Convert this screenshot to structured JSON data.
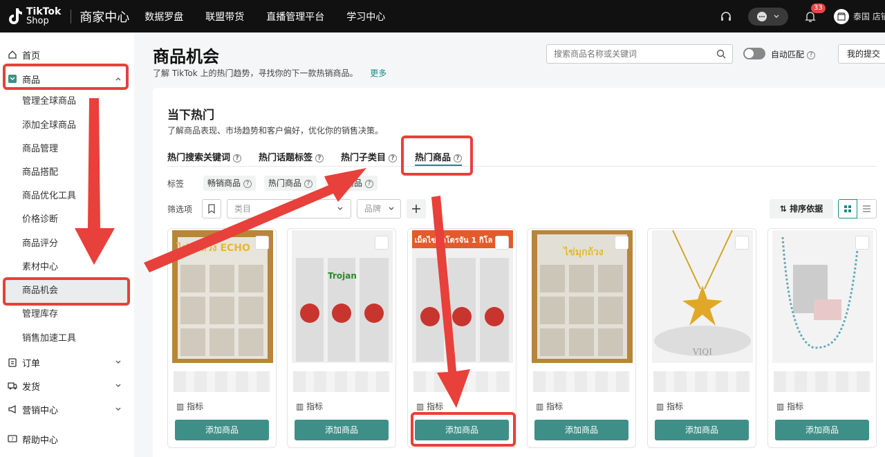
{
  "topbar": {
    "logo_line1": "TikTok",
    "logo_line2": "Shop",
    "app_title": "商家中心",
    "nav": [
      "数据罗盘",
      "联盟带货",
      "直播管理平台",
      "学习中心"
    ],
    "notification_count": "33",
    "store_name": "泰国 店铺"
  },
  "sidebar": {
    "home": "首页",
    "products": "商品",
    "product_subitems": [
      "管理全球商品",
      "添加全球商品",
      "商品管理",
      "商品搭配",
      "商品优化工具",
      "价格诊断",
      "商品评分",
      "素材中心",
      "商品机会",
      "管理库存",
      "销售加速工具"
    ],
    "orders": "订单",
    "shipping": "发货",
    "marketing": "营销中心",
    "help": "帮助中心"
  },
  "header": {
    "title": "商品机会",
    "subtitle": "了解 TikTok 上的热门趋势，寻找你的下一款热销商品。",
    "more_link": "更多",
    "search_placeholder": "搜索商品名称或关键词",
    "auto_match_label": "自动匹配",
    "my_submissions": "我的提交"
  },
  "section": {
    "title": "当下热门",
    "subtitle": "了解商品表现、市场趋势和客户偏好，优化你的销售决策。",
    "tabs": [
      "热门搜索关键词",
      "热门话题标签",
      "热门子类目",
      "热门商品"
    ],
    "active_tab": "热门商品",
    "tag_label": "标签",
    "tags": [
      "畅销商品",
      "热门商品",
      "精选商品"
    ],
    "filter_label": "筛选项",
    "category_placeholder": "类目",
    "brand_placeholder": "品牌",
    "sort_label": "排序依据"
  },
  "products": [
    {
      "image_text": "ไข่มุกถ้วง ECHO",
      "metric": "指标",
      "button": "添加商品",
      "theme": "bag"
    },
    {
      "image_text": "Trojan",
      "metric": "指标",
      "button": "添加商品",
      "theme": "bag-red"
    },
    {
      "image_text": "เม็ดไข่มุกโตรจัน 1 กิโล",
      "metric": "指标",
      "button": "添加商品",
      "theme": "bag-red"
    },
    {
      "image_text": "ไข่มุกถ้วง",
      "metric": "指标",
      "button": "添加商品",
      "theme": "bag"
    },
    {
      "image_text": "VIQI",
      "metric": "指标",
      "button": "添加商品",
      "theme": "jewel"
    },
    {
      "image_text": "",
      "metric": "指标",
      "button": "添加商品",
      "theme": "beads"
    }
  ],
  "colors": {
    "accent": "#3e8f87",
    "annotation": "#e8403a",
    "topbar": "#111111"
  }
}
